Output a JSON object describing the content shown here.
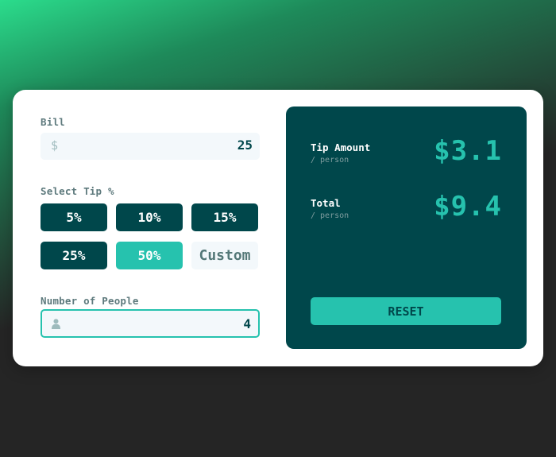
{
  "bill": {
    "label": "Bill",
    "currency_symbol": "$",
    "value": "25"
  },
  "tip": {
    "label": "Select Tip %",
    "options": [
      "5%",
      "10%",
      "15%",
      "25%",
      "50%"
    ],
    "selected": "50%",
    "custom_placeholder": "Custom"
  },
  "people": {
    "label": "Number of People",
    "icon": "person-icon",
    "value": "4"
  },
  "results": {
    "tip_amount_label": "Tip Amount",
    "tip_amount_sub": "/ person",
    "tip_amount_value": "$3.1",
    "total_label": "Total",
    "total_sub": "/ person",
    "total_value": "$9.4",
    "reset_label": "RESET"
  },
  "colors": {
    "dark_green": "#00474b",
    "accent": "#26c2ae",
    "input_bg": "#f3f8fb"
  }
}
